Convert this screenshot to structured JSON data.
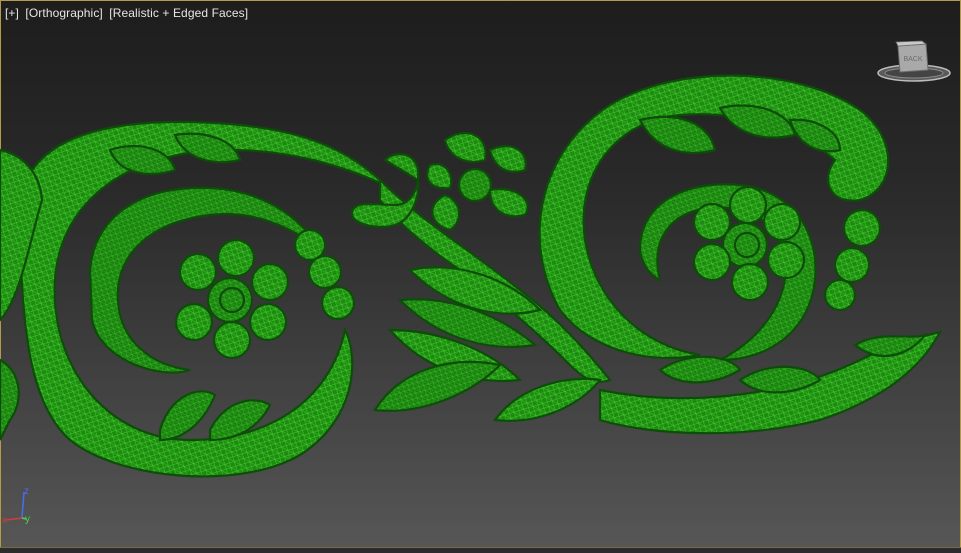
{
  "viewport": {
    "label": {
      "menu": "[+]",
      "view": "[Orthographic]",
      "shading": "[Realistic + Edged Faces]"
    },
    "viewcube": {
      "face": "BACK"
    },
    "axes": {
      "x": "x",
      "y": "y",
      "z": "z"
    }
  },
  "colors": {
    "mesh_fill": "#1e8a12",
    "mesh_wire": "#3fd02a",
    "mesh_dark": "#0d4a08",
    "axis_x": "#d23c3c",
    "axis_y": "#4fd04f",
    "axis_z": "#4a6cf0",
    "border": "#b59a4a"
  },
  "icons": [
    "viewcube-icon",
    "axis-gizmo-icon"
  ]
}
